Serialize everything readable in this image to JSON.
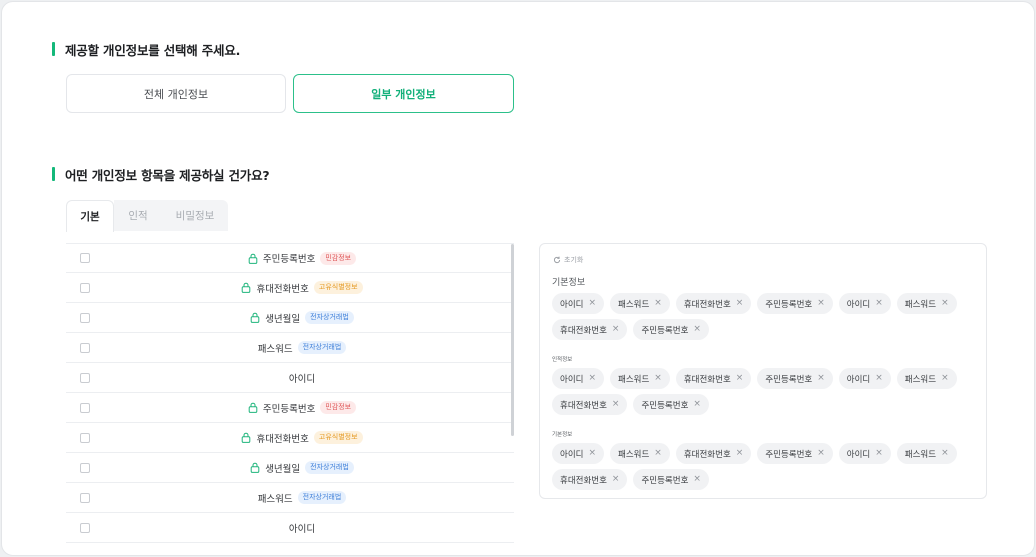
{
  "section1": {
    "title": "제공할 개인정보를 선택해 주세요."
  },
  "choices": {
    "all": "전체 개인정보",
    "partial": "일부 개인정보"
  },
  "section2": {
    "title": "어떤 개인정보 항목을 제공하실 건가요?"
  },
  "tabs": [
    {
      "label": "기본"
    },
    {
      "label": "인적"
    },
    {
      "label": "비밀정보"
    }
  ],
  "rows": [
    {
      "label": "주민등록번호",
      "lock": true,
      "badge": "민감정보",
      "badge_color": "red"
    },
    {
      "label": "휴대전화번호",
      "lock": true,
      "badge": "고유식별정보",
      "badge_color": "orange"
    },
    {
      "label": "생년월일",
      "lock": true,
      "badge": "전자상거래법",
      "badge_color": "blue"
    },
    {
      "label": "패스워드",
      "lock": false,
      "badge": "전자상거래법",
      "badge_color": "blue"
    },
    {
      "label": "아이디",
      "lock": false,
      "badge": "",
      "badge_color": ""
    },
    {
      "label": "주민등록번호",
      "lock": true,
      "badge": "민감정보",
      "badge_color": "red"
    },
    {
      "label": "휴대전화번호",
      "lock": true,
      "badge": "고유식별정보",
      "badge_color": "orange"
    },
    {
      "label": "생년월일",
      "lock": true,
      "badge": "전자상거래법",
      "badge_color": "blue"
    },
    {
      "label": "패스워드",
      "lock": false,
      "badge": "전자상거래법",
      "badge_color": "blue"
    },
    {
      "label": "아이디",
      "lock": false,
      "badge": "",
      "badge_color": ""
    }
  ],
  "panel": {
    "reset_label": "초기화",
    "groups": [
      {
        "title": "기본정보",
        "chips": [
          "아이디",
          "패스워드",
          "휴대전화번호",
          "주민등록번호",
          "아이디",
          "패스워드",
          "휴대전화번호",
          "주민등록번호"
        ]
      },
      {
        "title": "인적정보",
        "chips": [
          "아이디",
          "패스워드",
          "휴대전화번호",
          "주민등록번호",
          "아이디",
          "패스워드",
          "휴대전화번호",
          "주민등록번호"
        ]
      },
      {
        "title": "기본정보",
        "chips": [
          "아이디",
          "패스워드",
          "휴대전화번호",
          "주민등록번호",
          "아이디",
          "패스워드",
          "휴대전화번호",
          "주민등록번호"
        ]
      }
    ]
  },
  "colors": {
    "accent": "#14b87a",
    "accent_border": "#2cc08a"
  },
  "icons": {
    "lock": "lock-icon",
    "remove": "close-icon",
    "reset": "refresh-icon"
  }
}
